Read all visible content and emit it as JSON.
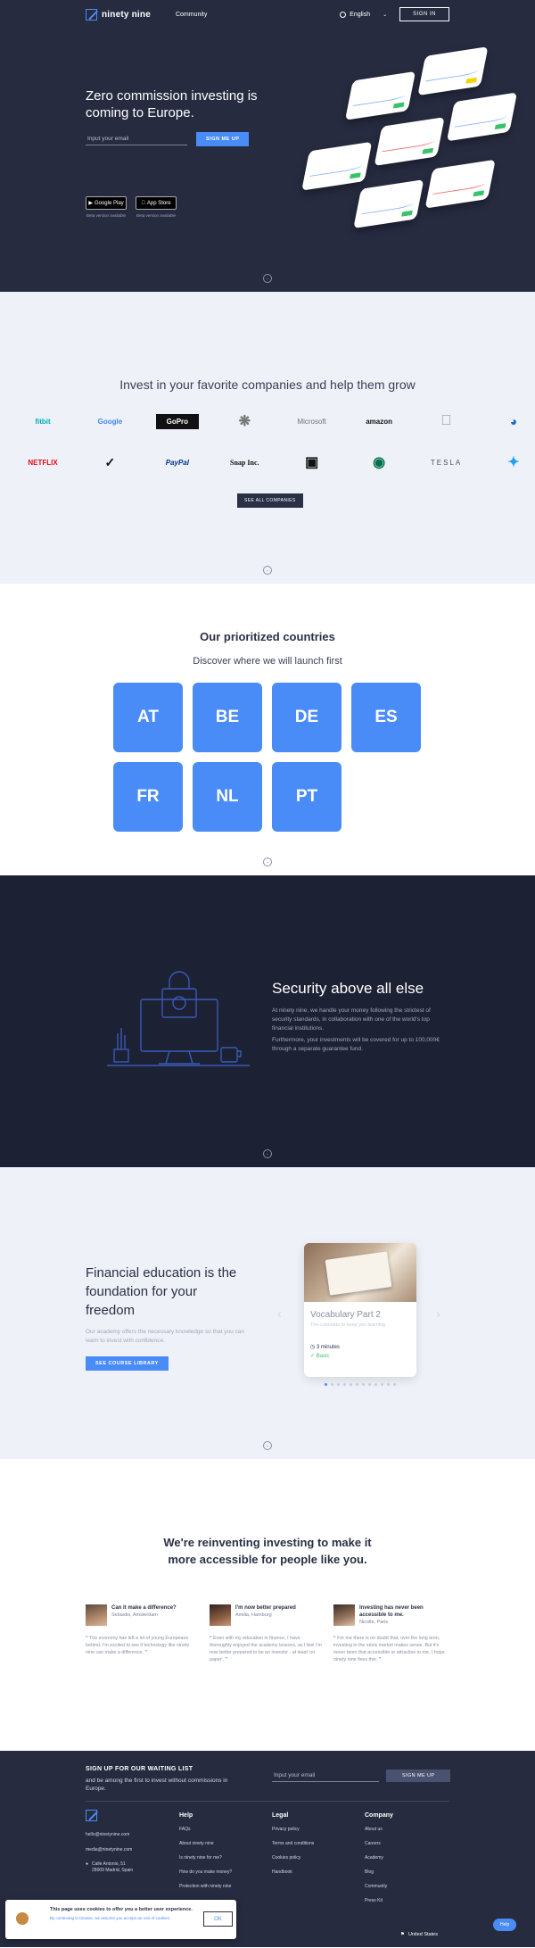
{
  "nav": {
    "brand": "ninety nine",
    "community": "Community",
    "language": "English",
    "signin": "SIGN IN"
  },
  "hero": {
    "title": "Zero commission investing is coming to Europe.",
    "email_placeholder": "Input your email",
    "signup": "SIGN ME UP",
    "google_play": "Google Play",
    "app_store": "App Store",
    "beta_note": "Beta version available"
  },
  "companies": {
    "title": "Invest in your favorite companies and help them grow",
    "row1": [
      "fitbit",
      "Google",
      "GoPro",
      "Mercedes",
      "Microsoft",
      "amazon",
      "Apple",
      "BMW"
    ],
    "row2": [
      "NETFLIX",
      "Nike",
      "PayPal",
      "Snap Inc.",
      "Square",
      "Starbucks",
      "TESLA",
      "Twitter"
    ],
    "button": "SEE ALL COMPANIES"
  },
  "countries": {
    "title": "Our prioritized countries",
    "subtitle": "Discover where we will launch first",
    "codes": [
      "AT",
      "BE",
      "DE",
      "ES",
      "FR",
      "NL",
      "PT"
    ]
  },
  "security": {
    "title": "Security above all else",
    "p1": "At ninety nine, we handle your money following the strictest of security standards, in collaboration with one of the world's top financial institutions.",
    "p2": "Furthermore, your investments will be covered for up to 100,000€ through a separate guarantee fund."
  },
  "education": {
    "title": "Financial education is the foundation for your freedom",
    "text": "Our academy offers the necessary knowledge so that you can learn to invest with confidence.",
    "button": "SEE COURSE LIBRARY",
    "course": {
      "title": "Vocabulary Part 2",
      "description": "The concepts to keep you learning",
      "duration": "3 minutes",
      "level": "Basic"
    },
    "slide_count": 12,
    "active_slide": 1
  },
  "testimonials": {
    "title": "We're reinventing investing to make it more accessible for people like you.",
    "items": [
      {
        "title": "Can it make a difference?",
        "name": "Sebastis, Amsterdam",
        "quote": "The economy has left a lot of young Europeans behind. I'm excited to see if technology like ninety nine can make a difference."
      },
      {
        "title": "I'm now better prepared",
        "name": "Amilia, Hamburg",
        "quote": "Even with my education in finance, I have thoroughly enjoyed the academy lessons, as I feel I'm now better prepared to be an investor - at least 'on paper'."
      },
      {
        "title": "Investing has never been accessible to me.",
        "name": "Nicolle, Paris",
        "quote": "For me there is no doubt that, over the long term, investing in the stock market makes sense. But it's never been that accessible or attractive to me. I hope ninety nine fixes this."
      }
    ]
  },
  "footer": {
    "signup_title": "SIGN UP FOR OUR WAITING LIST",
    "signup_sub": "and be among the first to invest without commissions in Europe.",
    "email_placeholder": "Input your email",
    "signup_button": "SIGN ME UP",
    "email1": "hello@ninetynine.com",
    "email2": "media@ninetynine.com",
    "address": "Calle Antonio, 51 28009 Madrid, Spain",
    "help": {
      "title": "Help",
      "links": [
        "FAQs",
        "About ninety nine",
        "Is ninety nine for me?",
        "How do you make money?",
        "Protection with ninety nine"
      ]
    },
    "legal": {
      "title": "Legal",
      "links": [
        "Privacy policy",
        "Terms and conditions",
        "Cookies policy",
        "Handbook"
      ]
    },
    "company": {
      "title": "Company",
      "links": [
        "About us",
        "Careers",
        "Academy",
        "Blog",
        "Community",
        "Press Kit"
      ]
    },
    "country": "United States"
  },
  "cookie": {
    "title": "This page uses cookies to offer you a better user experience.",
    "text": "By continuing to browse, we assume you accept our use of cookies.",
    "ok": "OK"
  },
  "help_button": "Help"
}
